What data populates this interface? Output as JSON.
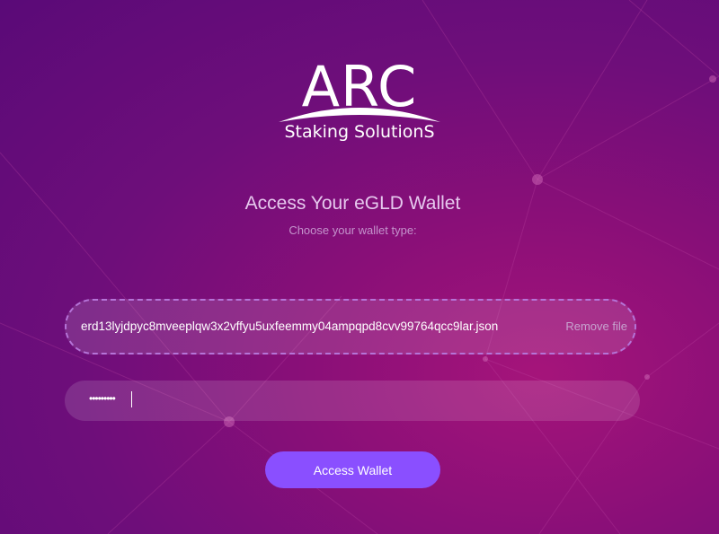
{
  "logo": {
    "brand": "ARC",
    "tagline": "Staking SolutionS"
  },
  "header": {
    "title": "Access Your eGLD Wallet",
    "subtitle": "Choose your wallet type:"
  },
  "file_upload": {
    "file_name": "erd13lyjdpyc8mveeplqw3x2vffyu5uxfeemmy04ampqpd8cvv99764qcc9lar.json",
    "remove_label": "Remove file"
  },
  "password_field": {
    "masked_value": "•••••••••",
    "type": "password"
  },
  "actions": {
    "access_label": "Access Wallet"
  },
  "colors": {
    "background_top": "#5a0a78",
    "background_accent": "#a5147a",
    "button": "#8a4fff",
    "dashed_border": "#b574d8",
    "title": "#e6c8ee",
    "subtitle": "#c493cc"
  }
}
